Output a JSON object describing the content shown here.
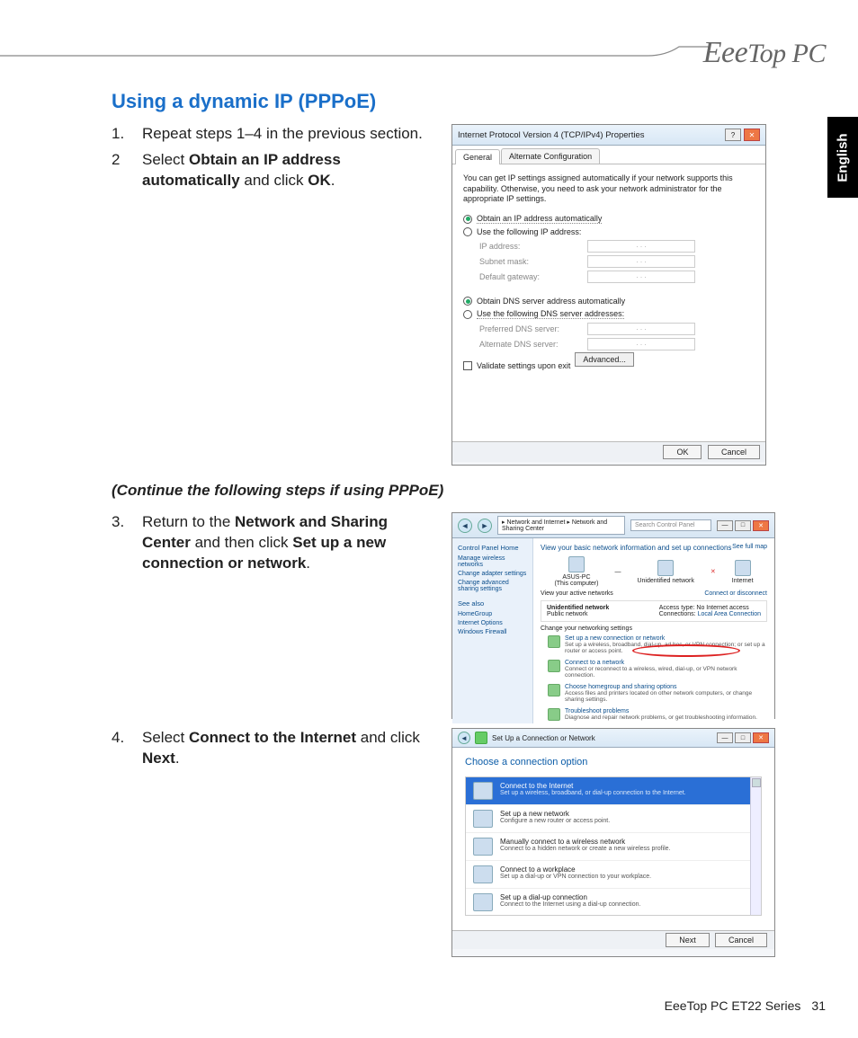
{
  "header": {
    "brand": "EeeTop PC",
    "language_tab": "English"
  },
  "section": {
    "title": "Using a dynamic IP (PPPoE)"
  },
  "steps": {
    "s1": {
      "num": "1.",
      "text": "Repeat steps 1–4 in the previous section."
    },
    "s2": {
      "num": "2",
      "pre": "Select ",
      "b1": "Obtain an IP address automatically",
      "mid": " and click ",
      "b2": "OK",
      "post": "."
    },
    "subhead": "(Continue the following steps if using PPPoE)",
    "s3": {
      "num": "3.",
      "pre": "Return to the ",
      "b1": "Network and Sharing Center",
      "mid": " and then click ",
      "b2": "Set up a new connection or network",
      "post": "."
    },
    "s4": {
      "num": "4.",
      "pre": "Select ",
      "b1": "Connect to the Internet",
      "mid": " and click ",
      "b2": "Next",
      "post": "."
    }
  },
  "shot1": {
    "title": "Internet Protocol Version 4 (TCP/IPv4) Properties",
    "help": "?",
    "tabs": {
      "general": "General",
      "alt": "Alternate Configuration"
    },
    "desc": "You can get IP settings assigned automatically if your network supports this capability. Otherwise, you need to ask your network administrator for the appropriate IP settings.",
    "r1": "Obtain an IP address automatically",
    "r2": "Use the following IP address:",
    "f_ip": "IP address:",
    "f_mask": "Subnet mask:",
    "f_gw": "Default gateway:",
    "r3": "Obtain DNS server address automatically",
    "r4": "Use the following DNS server addresses:",
    "f_pdns": "Preferred DNS server:",
    "f_adns": "Alternate DNS server:",
    "dots": ".   .   .",
    "chk": "Validate settings upon exit",
    "adv": "Advanced...",
    "ok": "OK",
    "cancel": "Cancel"
  },
  "shot2": {
    "crumb": "▸ Network and Internet ▸ Network and Sharing Center",
    "search": "Search Control Panel",
    "side_hd": "Control Panel Home",
    "side1": "Manage wireless networks",
    "side2": "Change adapter settings",
    "side3": "Change advanced sharing settings",
    "seealso": "See also",
    "sa1": "HomeGroup",
    "sa2": "Internet Options",
    "sa3": "Windows Firewall",
    "main_h": "View your basic network information and set up connections",
    "fullmap": "See full map",
    "node1": "ASUS-PC",
    "node1b": "(This computer)",
    "node2": "Unidentified network",
    "node3": "Internet",
    "view_active": "View your active networks",
    "conn_link": "Connect or disconnect",
    "an_name": "Unidentified network",
    "an_type": "Public network",
    "at_l": "Access type:",
    "at_v": "No Internet access",
    "cn_l": "Connections:",
    "cn_v": "Local Area Connection",
    "change_h": "Change your networking settings",
    "o1t": "Set up a new connection or network",
    "o1d": "Set up a wireless, broadband, dial-up, ad hoc, or VPN connection; or set up a router or access point.",
    "o2t": "Connect to a network",
    "o2d": "Connect or reconnect to a wireless, wired, dial-up, or VPN network connection.",
    "o3t": "Choose homegroup and sharing options",
    "o3d": "Access files and printers located on other network computers, or change sharing settings.",
    "o4t": "Troubleshoot problems",
    "o4d": "Diagnose and repair network problems, or get troubleshooting information."
  },
  "shot3": {
    "title": "Set Up a Connection or Network",
    "q": "Choose a connection option",
    "o1t": "Connect to the Internet",
    "o1d": "Set up a wireless, broadband, or dial-up connection to the Internet.",
    "o2t": "Set up a new network",
    "o2d": "Configure a new router or access point.",
    "o3t": "Manually connect to a wireless network",
    "o3d": "Connect to a hidden network or create a new wireless profile.",
    "o4t": "Connect to a workplace",
    "o4d": "Set up a dial-up or VPN connection to your workplace.",
    "o5t": "Set up a dial-up connection",
    "o5d": "Connect to the Internet using a dial-up connection.",
    "next": "Next",
    "cancel": "Cancel"
  },
  "footer": {
    "series": "EeeTop PC ET22 Series",
    "page": "31"
  }
}
